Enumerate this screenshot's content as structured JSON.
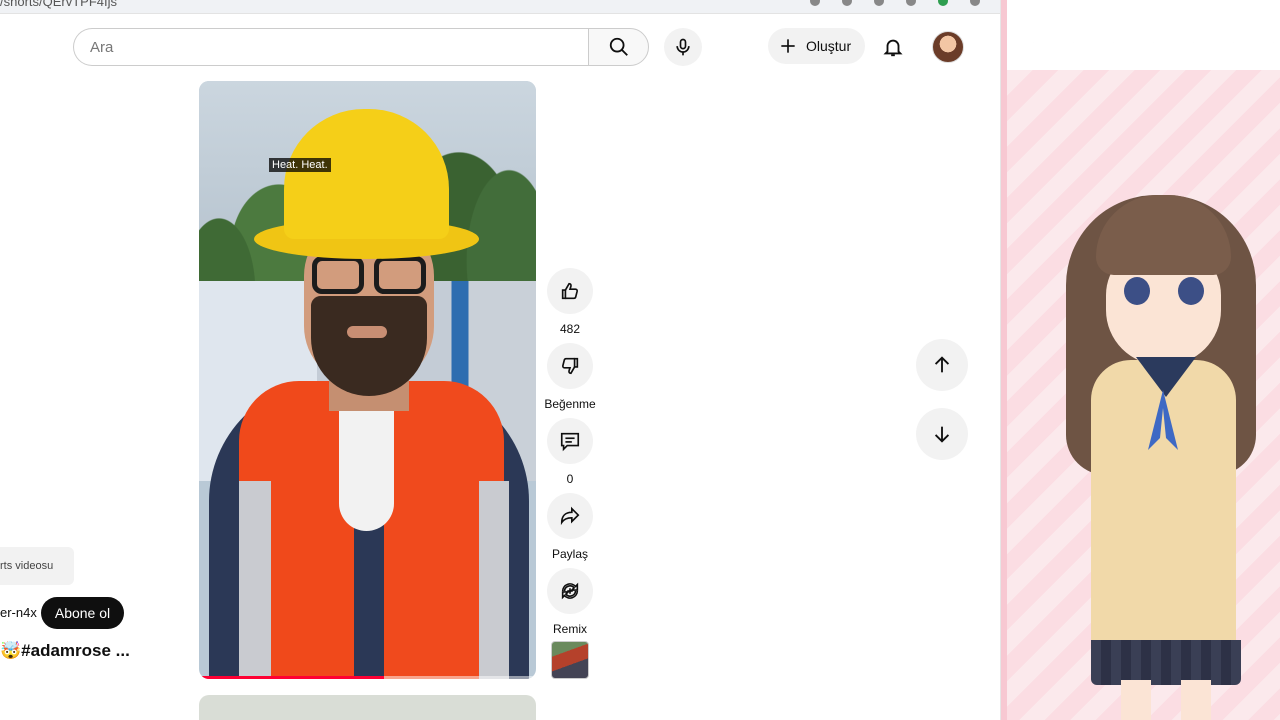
{
  "browser": {
    "url_fragment": "/shorts/QErvTPF4Ijs"
  },
  "header": {
    "search_placeholder": "Ara",
    "create_label": "Oluştur"
  },
  "video": {
    "caption": "Heat. Heat.",
    "progress_fraction": 0.55
  },
  "actions": {
    "like_count": "482",
    "dislike_label": "Beğenme",
    "comment_count": "0",
    "share_label": "Paylaş",
    "remix_label": "Remix"
  },
  "overlay": {
    "shorts_tag": "rts videosu",
    "channel_name": "er-n4x",
    "subscribe_label": "Abone ol",
    "title": "🤯#adamrose ..."
  },
  "icons": {
    "search": "search-icon",
    "mic": "microphone-icon",
    "create": "plus-icon",
    "bell": "bell-icon",
    "like": "thumbs-up-icon",
    "dislike": "thumbs-down-icon",
    "comment": "comment-icon",
    "share": "share-icon",
    "remix": "remix-icon",
    "up": "arrow-up-icon",
    "down": "arrow-down-icon"
  },
  "colors": {
    "subscribe_bg": "#0f0f0f",
    "progress": "#ff0033",
    "panel_pink": "#fbdde3"
  }
}
